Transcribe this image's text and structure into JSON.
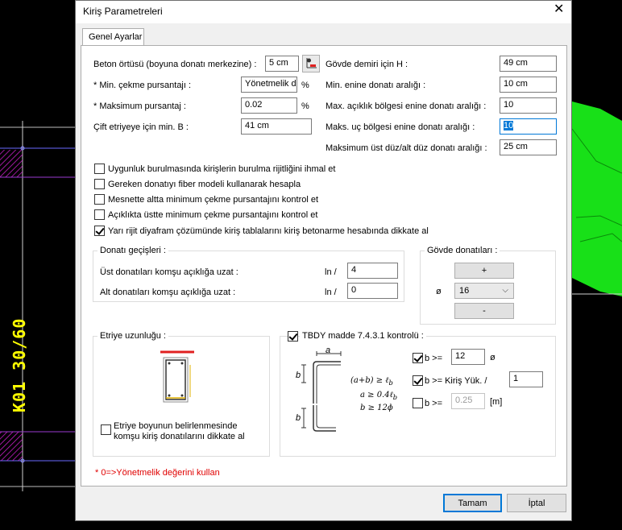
{
  "dialog": {
    "title": "Kiriş Parametreleri",
    "close_label": "✕"
  },
  "tab": {
    "label": "Genel Ayarlar"
  },
  "left_fields": {
    "beton_label": "Beton örtüsü (boyuna donatı merkezine) :",
    "beton_value": "5 cm",
    "min_cekme_label": "* Min. çekme pursantajı :",
    "min_cekme_value": "Yönetmelik de",
    "min_cekme_unit": "%",
    "maks_purs_label": "* Maksimum pursantaj :",
    "maks_purs_value": "0.02",
    "maks_purs_unit": "%",
    "cift_etriye_label": "Çift etriyeye için min. B :",
    "cift_etriye_value": "41 cm"
  },
  "right_fields": {
    "govde_h_label": "Gövde demiri için H :",
    "govde_h_value": "49 cm",
    "min_enine_label": "Min. enine donatı aralığı :",
    "min_enine_value": "10 cm",
    "max_aciklik_label": "Max. açıklık bölgesi enine donatı aralığı :",
    "max_aciklik_value": "10",
    "maks_uc_label": "Maks. uç bölgesi enine donatı aralığı :",
    "maks_uc_value": "10",
    "maks_ust_label": "Maksimum üst düz/alt düz donatı aralığı :",
    "maks_ust_value": "25 cm"
  },
  "checkboxes": [
    {
      "label": "Uygunluk burulmasında kirişlerin burulma rijitliğini ihmal et",
      "checked": false
    },
    {
      "label": "Gereken donatıyı fiber modeli kullanarak hesapla",
      "checked": false
    },
    {
      "label": "Mesnette altta minimum çekme pursantajını kontrol et",
      "checked": false
    },
    {
      "label": "Açıklıkta üstte minimum çekme pursantajını kontrol et",
      "checked": false
    },
    {
      "label": "Yarı rijit diyafram çözümünde kiriş tablalarını kiriş betonarme hesabında dikkate al",
      "checked": true
    }
  ],
  "donati_gecisleri": {
    "title": "Donatı geçişleri :",
    "ust_label": "Üst donatıları komşu açıklığa uzat :",
    "ust_unit": "ln /",
    "ust_value": "4",
    "alt_label": "Alt donatıları komşu açıklığa uzat :",
    "alt_unit": "ln /",
    "alt_value": "0"
  },
  "govde_donatilari": {
    "title": "Gövde donatıları :",
    "plus_label": "+",
    "phi_label": "ø",
    "combo_value": "16",
    "minus_label": "-"
  },
  "etriye": {
    "title": "Etriye uzunluğu :",
    "checkbox_label_1": "Etriye boyunun belirlenmesinde",
    "checkbox_label_2": "komşu kiriş donatılarını dikkate al"
  },
  "tbdy": {
    "title": "TBDY madde 7.4.3.1 kontrolü :",
    "sketch_a": "a",
    "sketch_b1": "b",
    "sketch_b2": "b",
    "formula_1": "(a+b) ≥ ℓ",
    "formula_1_sub": "b",
    "formula_2": "a ≥ 0.4ℓ",
    "formula_2_sub": "b",
    "formula_3": "b ≥ 12ɸ",
    "row1_label": "b >=",
    "row1_value": "12",
    "row1_unit": "ø",
    "row2_label": "b >= Kiriş Yük. /",
    "row2_value": "1",
    "row3_label": "b >=",
    "row3_value": "0.25",
    "row3_unit": "[m]"
  },
  "footnote": "* 0=>Yönetmelik değerini kullan",
  "buttons": {
    "ok": "Tamam",
    "cancel": "İptal"
  },
  "cad": {
    "label": "K01  30/60"
  }
}
